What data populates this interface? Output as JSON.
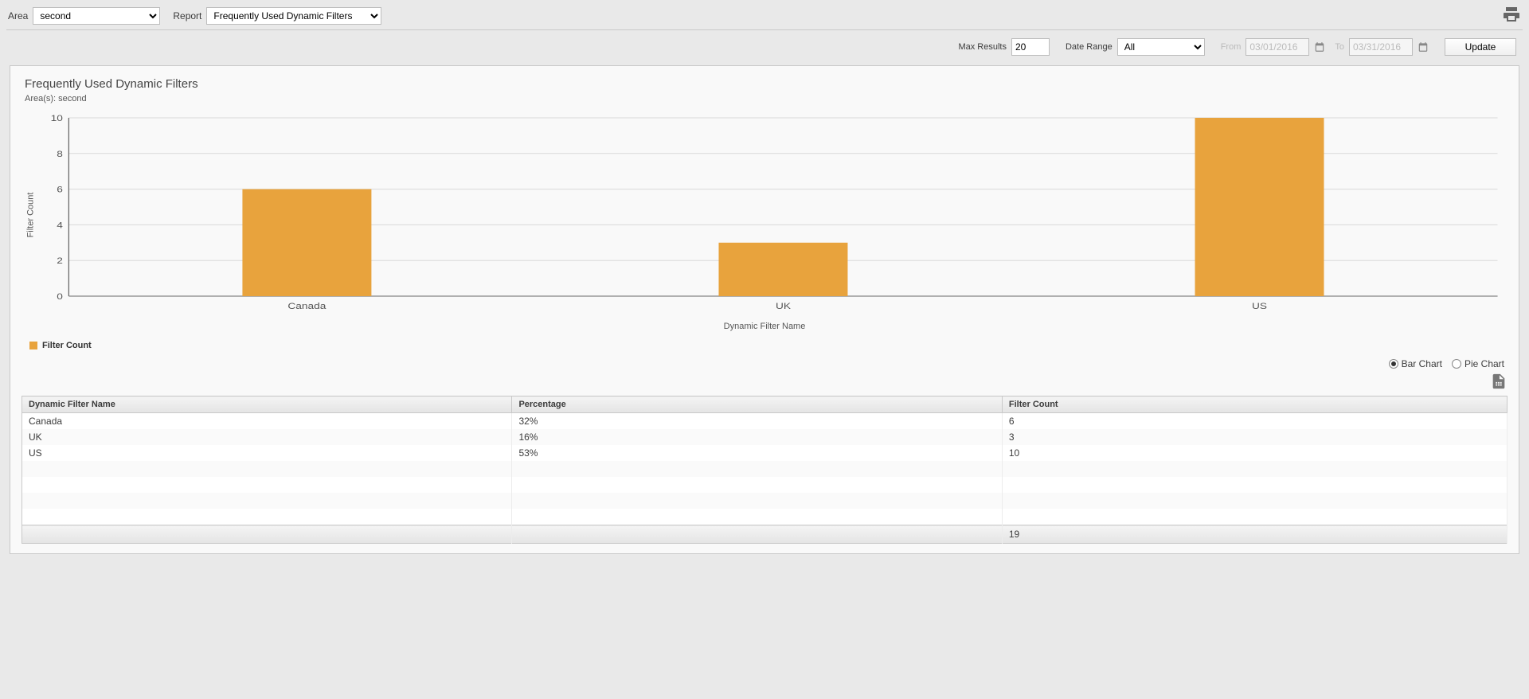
{
  "toolbar": {
    "area_label": "Area",
    "area_value": "second",
    "report_label": "Report",
    "report_value": "Frequently Used Dynamic Filters"
  },
  "filters": {
    "max_results_label": "Max Results",
    "max_results_value": "20",
    "date_range_label": "Date Range",
    "date_range_value": "All",
    "from_label": "From",
    "from_value": "03/01/2016",
    "to_label": "To",
    "to_value": "03/31/2016",
    "update_label": "Update"
  },
  "report": {
    "title": "Frequently Used Dynamic Filters",
    "subtitle": "Area(s): second"
  },
  "chart_controls": {
    "bar_label": "Bar Chart",
    "pie_label": "Pie Chart",
    "selected": "bar"
  },
  "legend": {
    "label": "Filter Count"
  },
  "chart_data": {
    "type": "bar",
    "title": "Frequently Used Dynamic Filters",
    "xlabel": "Dynamic Filter Name",
    "ylabel": "Filter Count",
    "ylim": [
      0,
      10
    ],
    "yticks": [
      0,
      2,
      4,
      6,
      8,
      10
    ],
    "categories": [
      "Canada",
      "UK",
      "US"
    ],
    "values": [
      6,
      3,
      10
    ],
    "series_name": "Filter Count",
    "color": "#e8a33d"
  },
  "table": {
    "columns": [
      "Dynamic Filter Name",
      "Percentage",
      "Filter Count"
    ],
    "rows": [
      {
        "name": "Canada",
        "pct": "32%",
        "count": "6"
      },
      {
        "name": "UK",
        "pct": "16%",
        "count": "3"
      },
      {
        "name": "US",
        "pct": "53%",
        "count": "10"
      }
    ],
    "empty_rows": 4,
    "footer_total": "19"
  }
}
